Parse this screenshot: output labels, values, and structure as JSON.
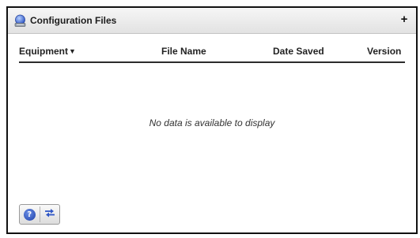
{
  "panel": {
    "title": "Configuration Files",
    "icon": "configuration-files-icon",
    "expand_label": "+"
  },
  "table": {
    "columns": [
      {
        "label": "Equipment",
        "sort": "descending"
      },
      {
        "label": "File Name"
      },
      {
        "label": "Date Saved"
      },
      {
        "label": "Version"
      }
    ],
    "rows": [],
    "empty_message": "No data is available to display"
  },
  "toolbar": {
    "buttons": [
      {
        "icon": "help-icon",
        "glyph": "?"
      },
      {
        "icon": "swap-arrows-icon"
      }
    ]
  },
  "colors": {
    "header_bg": "#e8e8e8",
    "icon_blue": "#2f56c6",
    "border": "#111111"
  }
}
